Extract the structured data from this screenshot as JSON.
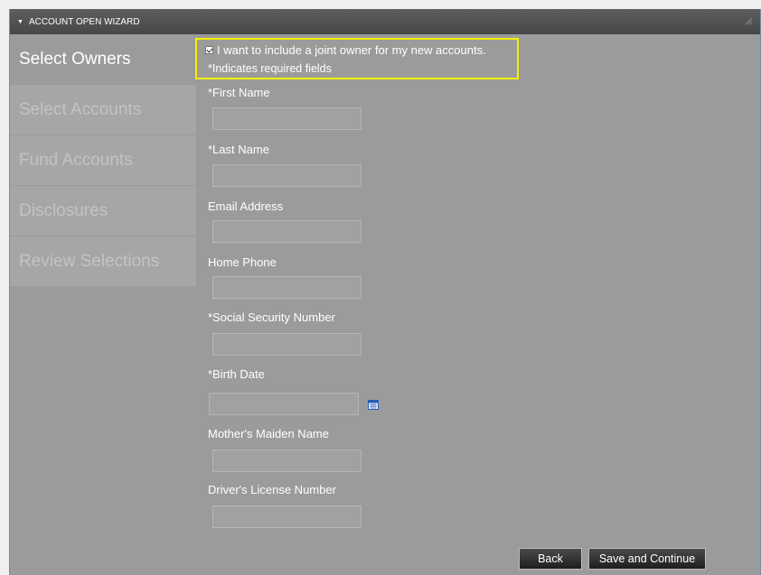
{
  "wizard": {
    "title": "ACCOUNT OPEN WIZARD"
  },
  "sidebar": {
    "items": [
      {
        "label": "Select Owners",
        "active": true
      },
      {
        "label": "Select Accounts"
      },
      {
        "label": "Fund Accounts"
      },
      {
        "label": "Disclosures"
      },
      {
        "label": "Review Selections"
      }
    ]
  },
  "form": {
    "joint_owner": {
      "label": "I want to include a joint owner for my new accounts.",
      "checked": true
    },
    "required_note": "*Indicates required fields",
    "fields": [
      {
        "label": "*First Name",
        "value": ""
      },
      {
        "label": "*Last Name",
        "value": ""
      },
      {
        "label": "Email Address",
        "value": ""
      },
      {
        "label": "Home Phone",
        "value": ""
      },
      {
        "label": "*Social Security Number",
        "value": ""
      },
      {
        "label": "*Birth Date",
        "value": ""
      },
      {
        "label": "Mother's Maiden Name",
        "value": ""
      },
      {
        "label": "Driver's License Number",
        "value": ""
      }
    ]
  },
  "buttons": {
    "back": "Back",
    "save_continue": "Save and Continue"
  },
  "colors": {
    "highlight": "#f5f000",
    "panel": "#9b9b9b",
    "titlebar": "#4f4f4f"
  }
}
